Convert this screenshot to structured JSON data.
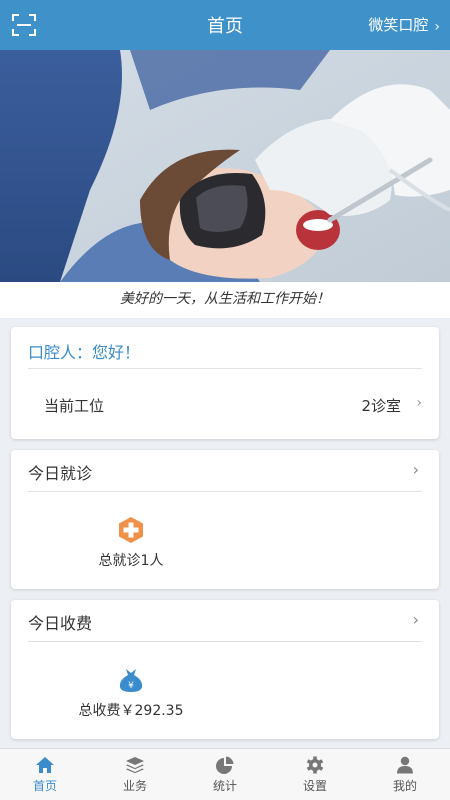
{
  "header": {
    "title": "首页",
    "clinic": "微笑口腔",
    "clinic_chevron": "›"
  },
  "hero": {
    "slogan": "美好的一天，从生活和工作开始！"
  },
  "greeting_card": {
    "greeting": "口腔人：您好！",
    "station_label": "当前工位",
    "station_value": "2诊室",
    "chevron": "›"
  },
  "visits_card": {
    "title": "今日就诊",
    "chevron": "›",
    "total_text": "总就诊1人",
    "icon": "plus-cross-icon"
  },
  "fees_card": {
    "title": "今日收费",
    "chevron": "›",
    "total_text": "总收费￥292.35",
    "icon": "money-bag-icon"
  },
  "bottom_nav": {
    "items": [
      {
        "label": "首页",
        "icon": "home-icon",
        "active": true
      },
      {
        "label": "业务",
        "icon": "layers-icon",
        "active": false
      },
      {
        "label": "统计",
        "icon": "pie-chart-icon",
        "active": false
      },
      {
        "label": "设置",
        "icon": "gear-icon",
        "active": false
      },
      {
        "label": "我的",
        "icon": "user-icon",
        "active": false
      }
    ]
  },
  "colors": {
    "primary": "#3f92c9",
    "accent_text": "#3a8ccd",
    "orange": "#f0914a"
  }
}
